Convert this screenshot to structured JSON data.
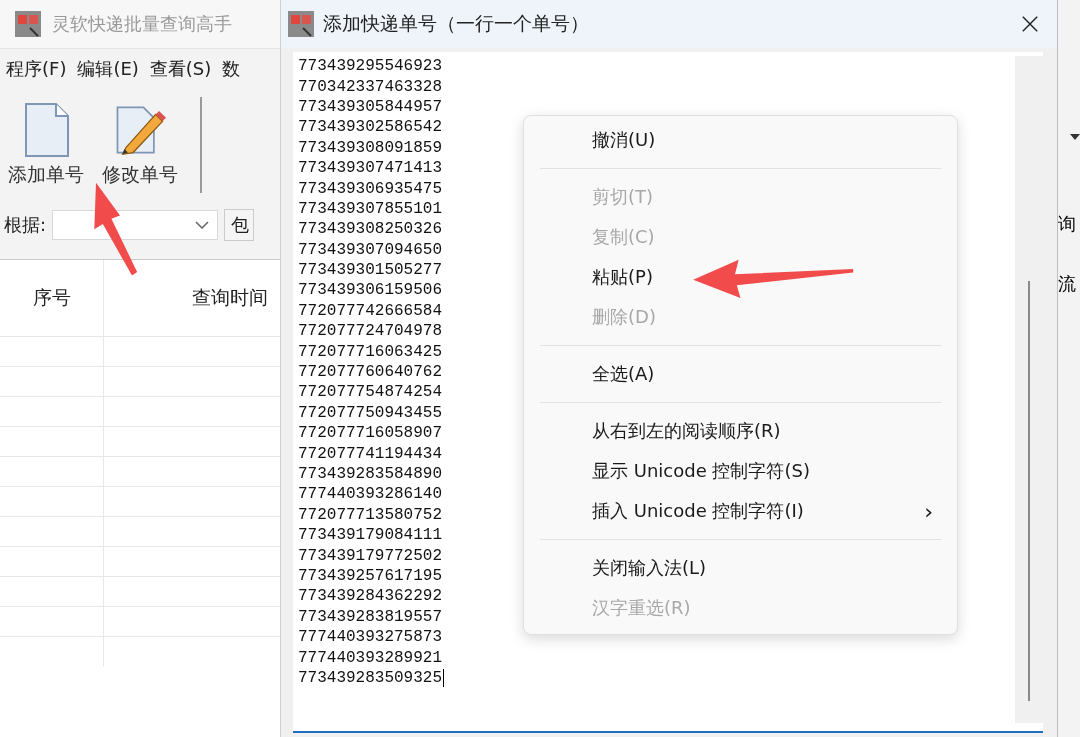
{
  "app": {
    "title": "灵软快递批量查询高手",
    "menu": [
      "程序(F)",
      "编辑(E)",
      "查看(S)",
      "数"
    ],
    "toolbar": [
      {
        "kind": "blank-doc",
        "label": "添加单号"
      },
      {
        "kind": "edit-doc",
        "label": "修改单号"
      }
    ],
    "filter": {
      "label": "根据:",
      "button": "包"
    },
    "table": {
      "columns": [
        "序号",
        "查询时间"
      ]
    },
    "right_edge": [
      "询",
      "流"
    ]
  },
  "dialog": {
    "title": "添加快递单号（一行一个单号）",
    "numbers": [
      "773439295546923",
      "770342337463328",
      "773439305844957",
      "773439302586542",
      "773439308091859",
      "773439307471413",
      "773439306935475",
      "773439307855101",
      "773439308250326",
      "773439307094650",
      "773439301505277",
      "773439306159506",
      "772077742666584",
      "772077724704978",
      "772077716063425",
      "772077760640762",
      "772077754874254",
      "772077750943455",
      "772077716058907",
      "772077741194434",
      "773439283584890",
      "777440393286140",
      "772077713580752",
      "773439179084111",
      "773439179772502",
      "773439257617195",
      "773439284362292",
      "773439283819557",
      "777440393275873",
      "777440393289921",
      "773439283509325"
    ]
  },
  "context_menu": [
    {
      "kind": "item",
      "label": "撤消(U)",
      "disabled": false
    },
    {
      "kind": "separator"
    },
    {
      "kind": "item",
      "label": "剪切(T)",
      "disabled": true
    },
    {
      "kind": "item",
      "label": "复制(C)",
      "disabled": true
    },
    {
      "kind": "item",
      "label": "粘贴(P)",
      "disabled": false
    },
    {
      "kind": "item",
      "label": "删除(D)",
      "disabled": true
    },
    {
      "kind": "separator"
    },
    {
      "kind": "item",
      "label": "全选(A)",
      "disabled": false
    },
    {
      "kind": "separator"
    },
    {
      "kind": "item",
      "label": "从右到左的阅读顺序(R)",
      "disabled": false
    },
    {
      "kind": "item",
      "label": "显示 Unicode 控制字符(S)",
      "disabled": false
    },
    {
      "kind": "item",
      "label": "插入 Unicode 控制字符(I)",
      "disabled": false,
      "submenu": "›"
    },
    {
      "kind": "separator"
    },
    {
      "kind": "item",
      "label": "关闭输入法(L)",
      "disabled": false
    },
    {
      "kind": "item",
      "label": "汉字重选(R)",
      "disabled": true
    }
  ]
}
